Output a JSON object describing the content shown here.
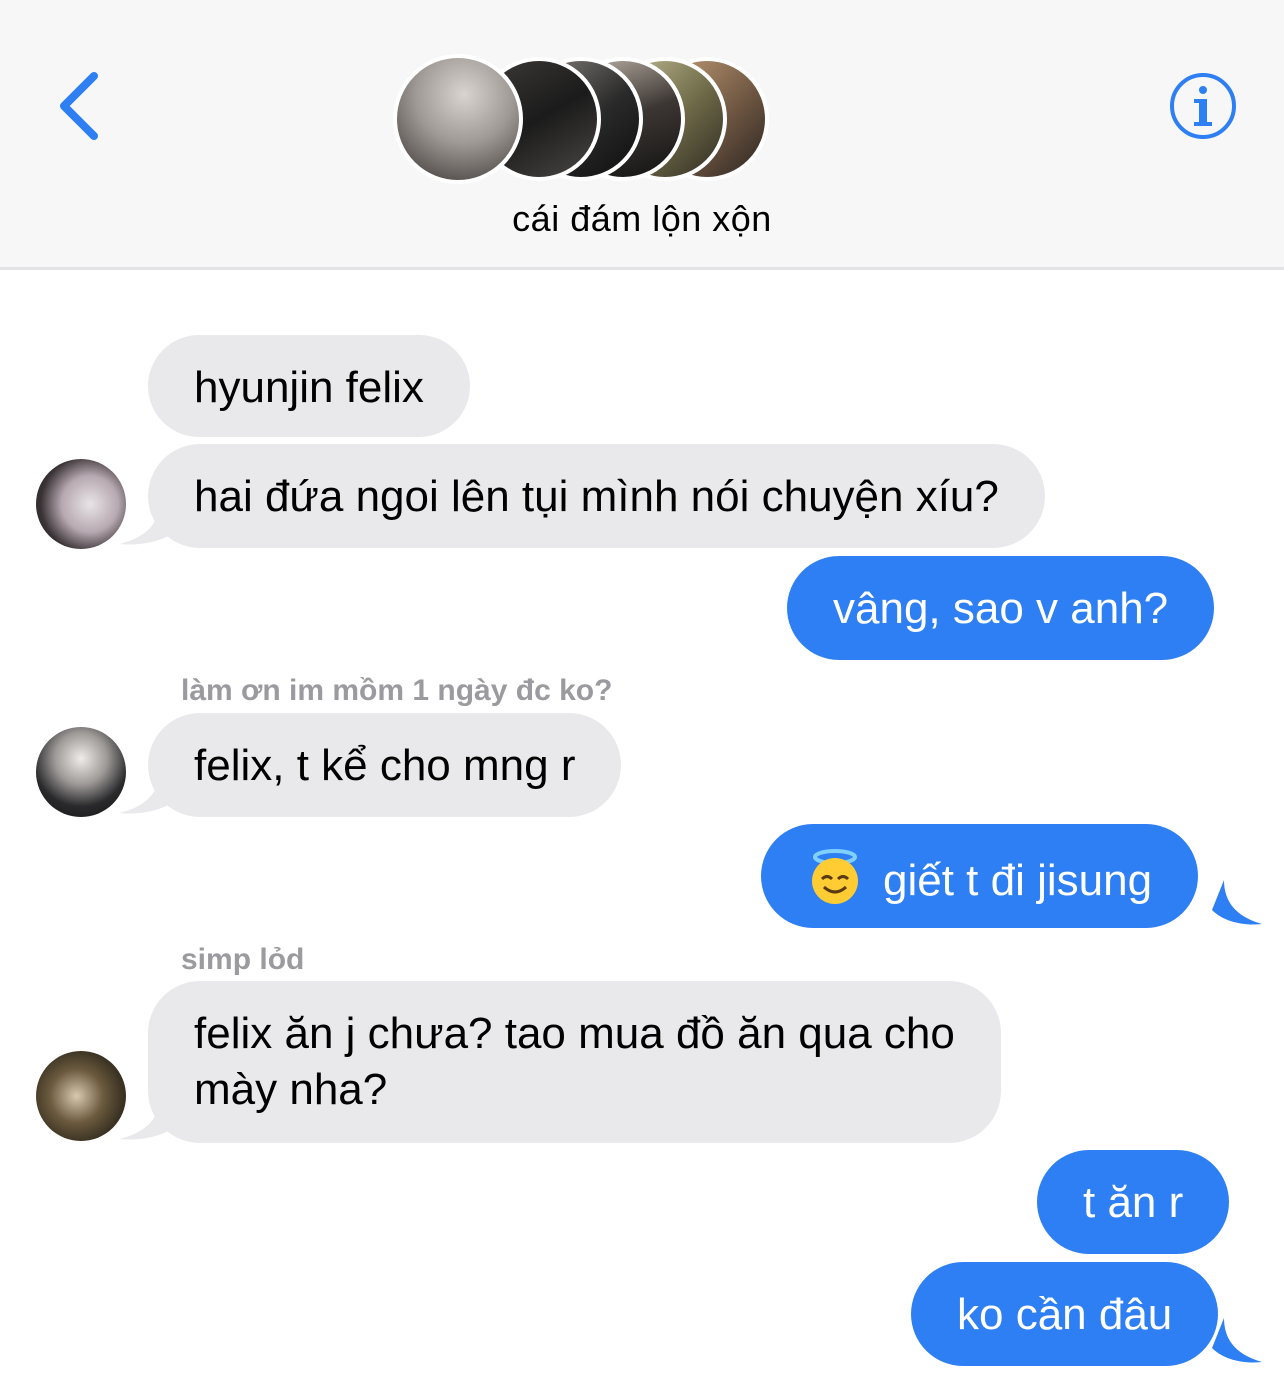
{
  "header": {
    "group_name": "cái đám lộn xộn",
    "back_icon": "chevron-left-icon",
    "info_icon": "info-icon",
    "avatar_count": 6
  },
  "colors": {
    "accent": "#2e7ff3",
    "received_bubble": "#e9e9eb",
    "sender_label": "#9a9a9f"
  },
  "messages": [
    {
      "type": "received",
      "text": "hyunjin felix"
    },
    {
      "type": "received",
      "text": "hai đứa ngoi lên tụi mình nói chuyện xíu?"
    },
    {
      "type": "sent",
      "text": "vâng, sao v anh?"
    },
    {
      "type": "received",
      "sender": "làm ơn im mồm 1 ngày đc ko?",
      "text": "felix, t kể cho mng r"
    },
    {
      "type": "sent",
      "emoji": "smiling-face-with-halo-icon",
      "text": "giết t đi jisung"
    },
    {
      "type": "received",
      "sender": "simp lỏd",
      "text_line1": "felix ăn j chưa? tao mua đồ ăn qua cho",
      "text_line2": "mày nha?"
    },
    {
      "type": "sent",
      "text": "t ăn r"
    },
    {
      "type": "sent",
      "text": "ko cần đâu"
    }
  ]
}
